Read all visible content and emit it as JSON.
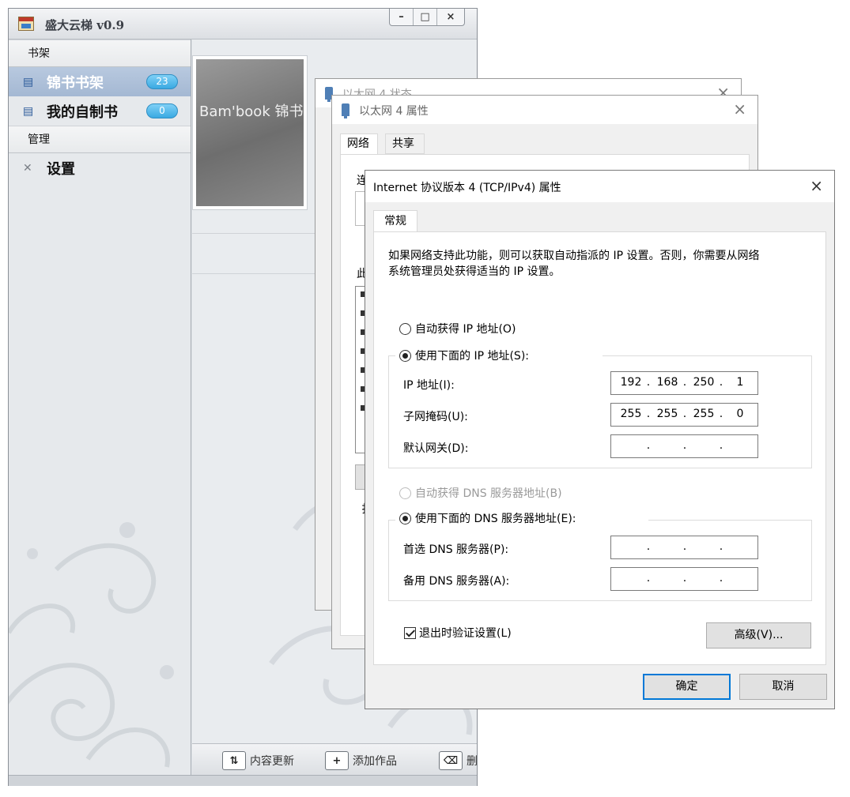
{
  "app": {
    "title": "盛大云梯 v0.9",
    "window_buttons": [
      "–",
      "□",
      "×"
    ],
    "sidebar": {
      "group1": "书架",
      "items1": [
        {
          "label": "锦书书架",
          "count": "23",
          "icon": "book-icon"
        },
        {
          "label": "我的自制书",
          "count": "0",
          "icon": "book-icon"
        }
      ],
      "group2": "管理",
      "items2": [
        {
          "label": "设置",
          "icon": "tools-icon"
        }
      ]
    },
    "book_brand": "Bam'book 锦书",
    "toolbar": [
      {
        "label": "内容更新",
        "icon": "refresh-icon"
      },
      {
        "label": "添加作品",
        "icon": "plus-icon"
      },
      {
        "label": "删",
        "icon": "trash-icon"
      }
    ]
  },
  "dlg_status": {
    "title": "以太网 4 状态",
    "close": "×"
  },
  "dlg_props": {
    "title": "以太网 4 属性",
    "close": "×",
    "tabs": [
      "网络",
      "共享"
    ],
    "peek_texts": [
      "连",
      "此",
      "扌"
    ]
  },
  "dlg_ipv4": {
    "title": "Internet 协议版本 4 (TCP/IPv4) 属性",
    "close": "×",
    "tab": "常规",
    "description_line1": "如果网络支持此功能，则可以获取自动指派的 IP 设置。否则，你需要从网络",
    "description_line2": "系统管理员处获得适当的 IP 设置。",
    "auto_ip": "自动获得 IP 地址(O)",
    "manual_ip": "使用下面的 IP 地址(S):",
    "ip_label": "IP 地址(I):",
    "ip_value": [
      "192",
      "168",
      "250",
      "1"
    ],
    "mask_label": "子网掩码(U):",
    "mask_value": [
      "255",
      "255",
      "255",
      "0"
    ],
    "gateway_label": "默认网关(D):",
    "gateway_value": [
      "",
      "",
      "",
      ""
    ],
    "auto_dns": "自动获得 DNS 服务器地址(B)",
    "manual_dns": "使用下面的 DNS 服务器地址(E):",
    "dns1_label": "首选 DNS 服务器(P):",
    "dns1_value": [
      "",
      "",
      "",
      ""
    ],
    "dns2_label": "备用 DNS 服务器(A):",
    "dns2_value": [
      "",
      "",
      "",
      ""
    ],
    "validate_label": "退出时验证设置(L)",
    "validate_checked": true,
    "advanced_button": "高级(V)...",
    "ok_button": "确定",
    "cancel_button": "取消"
  },
  "colors": {
    "accent": "#0078d7",
    "sidebar_active": "#a4b8d3",
    "badge": "#3aa9e2"
  }
}
